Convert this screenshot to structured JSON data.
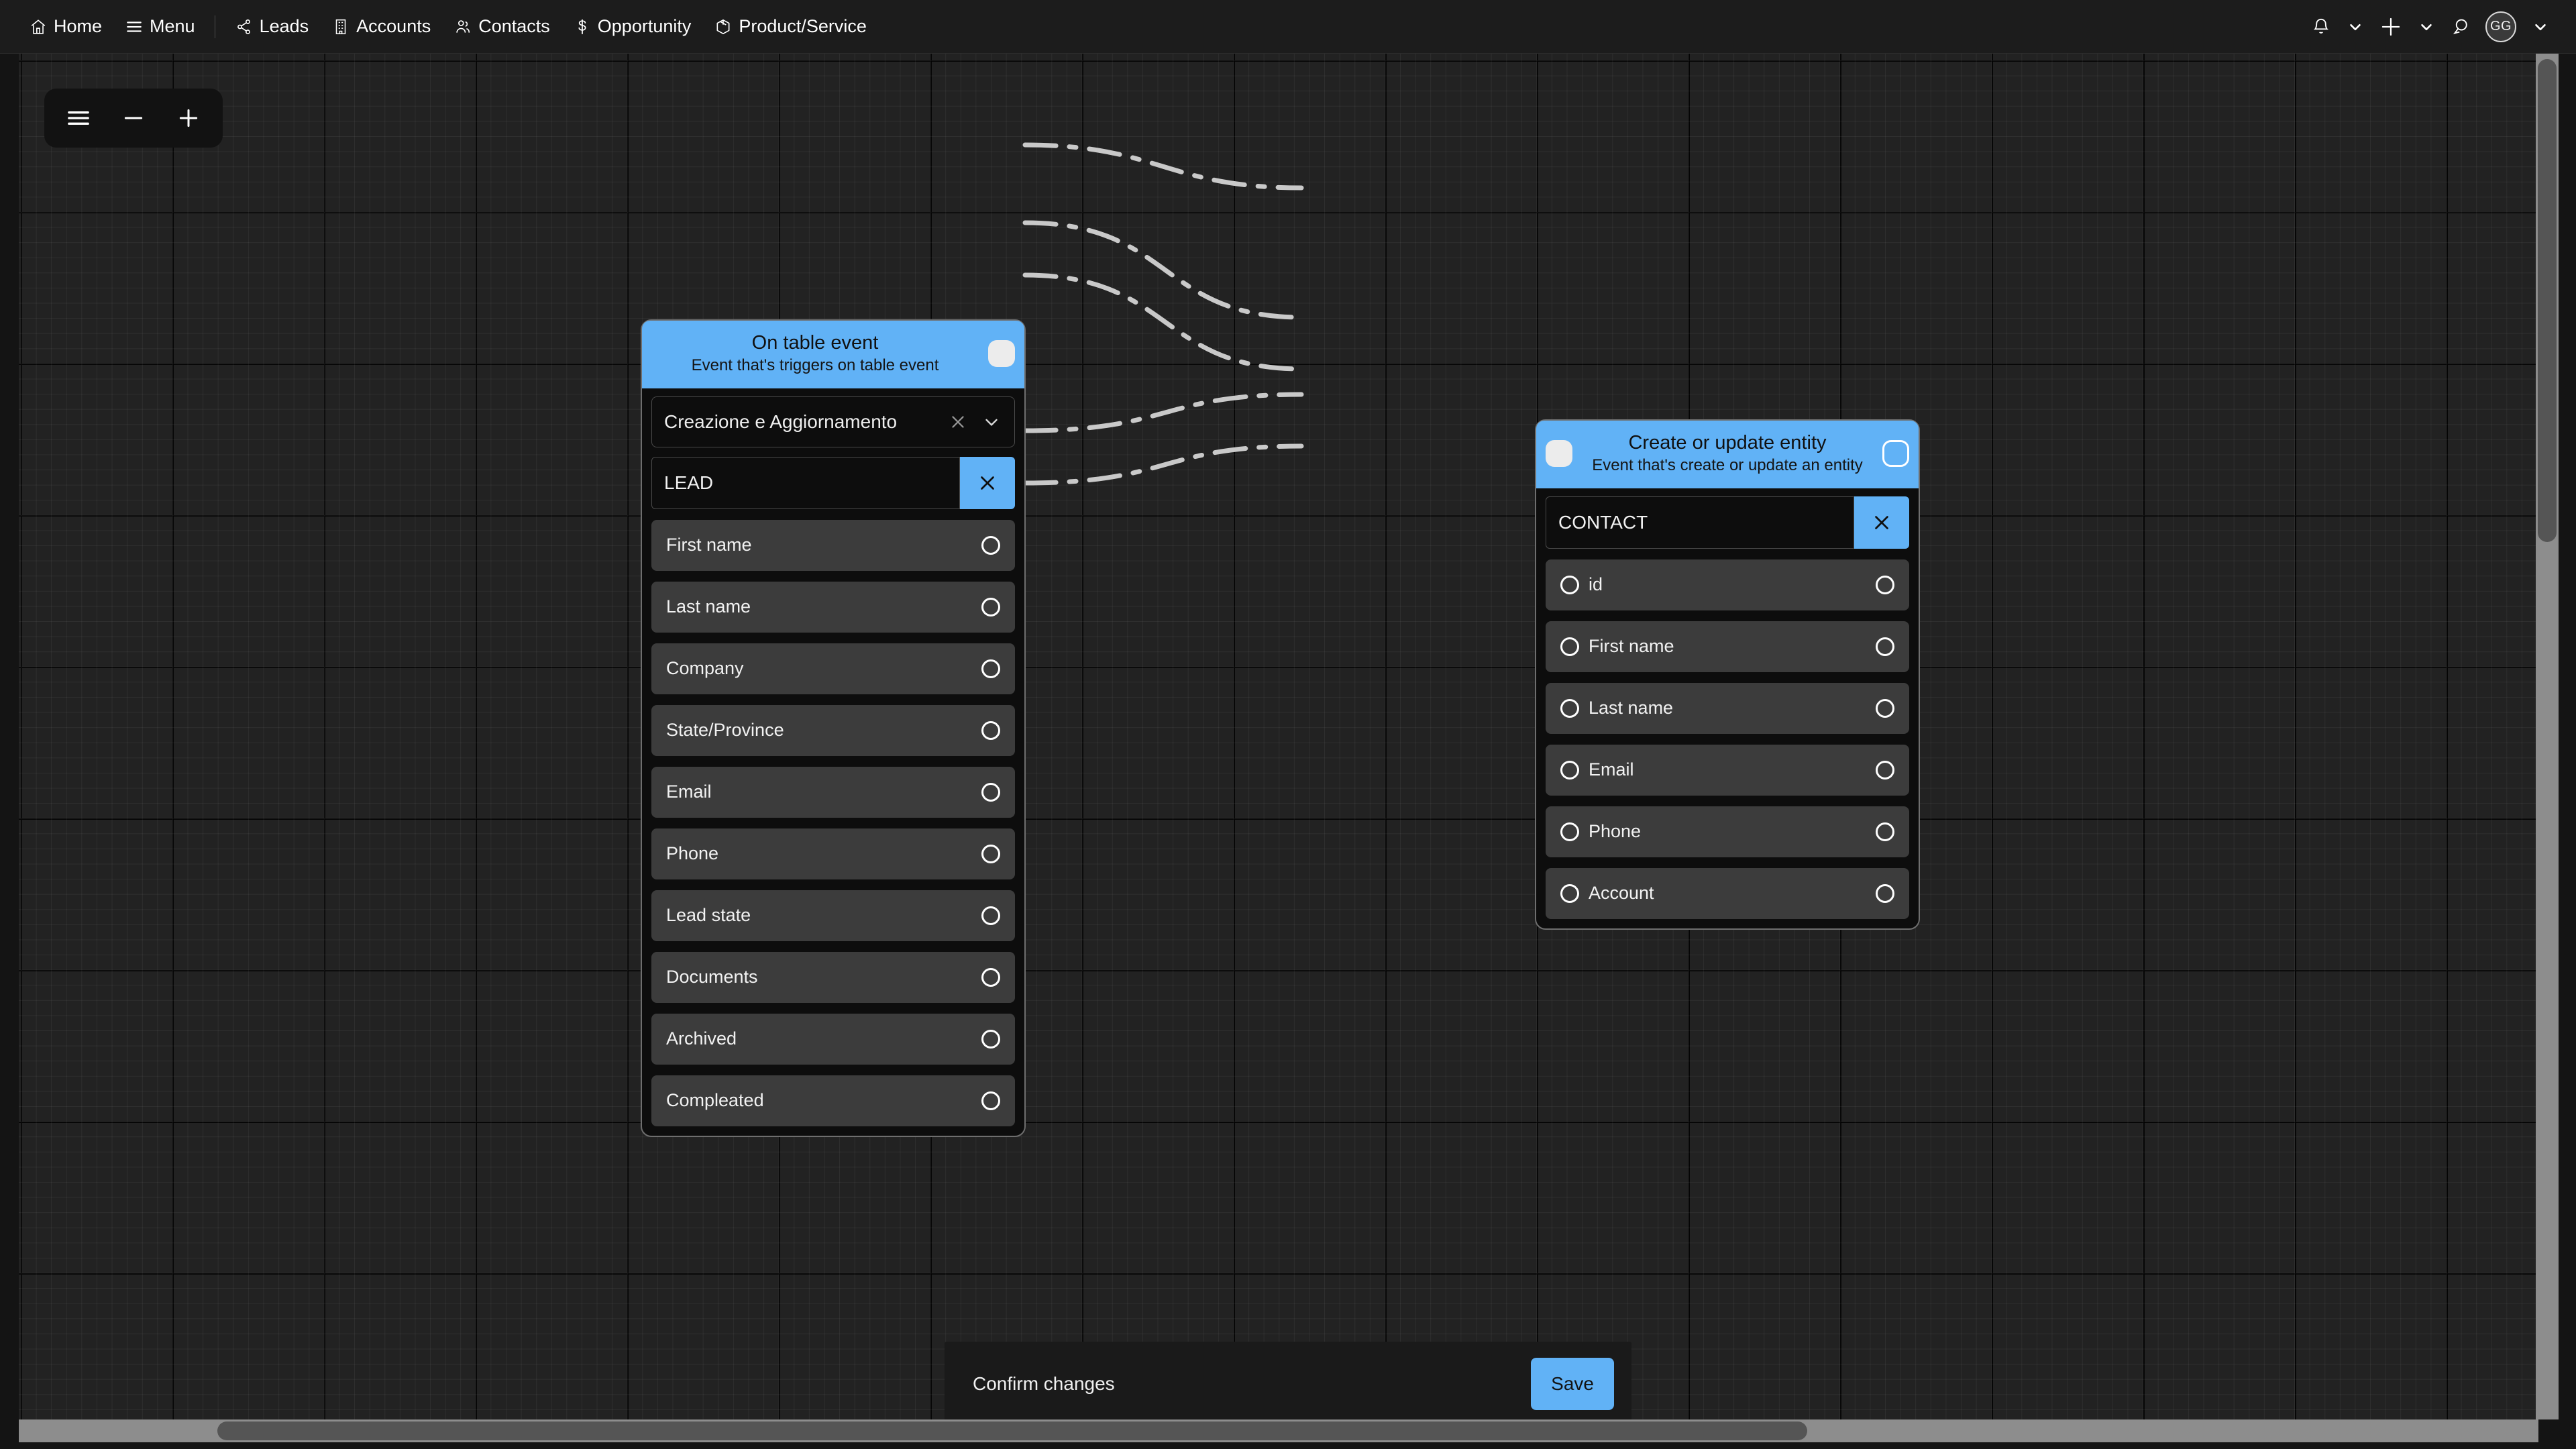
{
  "topnav": {
    "left_items": [
      {
        "label": "Home",
        "icon": "home-icon"
      },
      {
        "label": "Menu",
        "icon": "hamburger-icon"
      },
      {
        "label": "Leads",
        "icon": "share-nodes-icon"
      },
      {
        "label": "Accounts",
        "icon": "building-icon"
      },
      {
        "label": "Contacts",
        "icon": "people-icon"
      },
      {
        "label": "Opportunity",
        "icon": "dollar-icon"
      },
      {
        "label": "Product/Service",
        "icon": "box-icon"
      }
    ],
    "right_items": [
      {
        "icon": "bell-icon",
        "chevron": true
      },
      {
        "icon": "plus-icon",
        "chevron": true
      },
      {
        "icon": "chat-icon",
        "chevron": false
      }
    ],
    "avatar": {
      "initials": "GG",
      "chevron": true
    }
  },
  "toolbar": {
    "menu_icon": "hamburger-icon",
    "zoom_out_icon": "minus-icon",
    "zoom_in_icon": "plus-icon"
  },
  "nodes": {
    "trigger": {
      "title": "On table event",
      "subtitle": "Event that's triggers on table event",
      "output_port_icon": "square-port-filled",
      "event_select": {
        "value": "Creazione e Aggiornamento",
        "clear_icon": "close-icon",
        "chevron_icon": "chevron-down-icon"
      },
      "entity": {
        "value": "LEAD",
        "clear_icon": "close-icon"
      },
      "fields": [
        {
          "label": "First name",
          "right_port": true
        },
        {
          "label": "Last name",
          "right_port": true
        },
        {
          "label": "Company",
          "right_port": true
        },
        {
          "label": "State/Province",
          "right_port": true
        },
        {
          "label": "Email",
          "right_port": true
        },
        {
          "label": "Phone",
          "right_port": true
        },
        {
          "label": "Lead state",
          "right_port": true
        },
        {
          "label": "Documents",
          "right_port": true
        },
        {
          "label": "Archived",
          "right_port": true
        },
        {
          "label": "Compleated",
          "right_port": true
        }
      ]
    },
    "action": {
      "title": "Create or update entity",
      "subtitle": "Event that's create or update an entity",
      "input_port_icon": "square-port-filled",
      "output_port_icon": "square-port-open",
      "entity": {
        "value": "CONTACT",
        "clear_icon": "close-icon"
      },
      "fields": [
        {
          "label": "id",
          "left_port": true,
          "right_port": true
        },
        {
          "label": "First name",
          "left_port": true,
          "right_port": true
        },
        {
          "label": "Last name",
          "left_port": true,
          "right_port": true
        },
        {
          "label": "Email",
          "left_port": true,
          "right_port": true
        },
        {
          "label": "Phone",
          "left_port": true,
          "right_port": true
        },
        {
          "label": "Account",
          "left_port": true,
          "right_port": true
        }
      ]
    }
  },
  "connections": [
    {
      "from": "trigger.header",
      "to": "action.header"
    },
    {
      "from": "trigger.First name",
      "to": "action.First name"
    },
    {
      "from": "trigger.Last name",
      "to": "action.Last name"
    },
    {
      "from": "trigger.Email",
      "to": "action.Email"
    },
    {
      "from": "trigger.Phone",
      "to": "action.Phone"
    }
  ],
  "confirm_bar": {
    "message": "Confirm changes",
    "save_label": "Save"
  },
  "colors": {
    "accent": "#61b2f6",
    "canvas": "#222222",
    "node_body": "#0d0d0d",
    "field": "#3c3c3c",
    "topnav": "#1c1c1c"
  }
}
